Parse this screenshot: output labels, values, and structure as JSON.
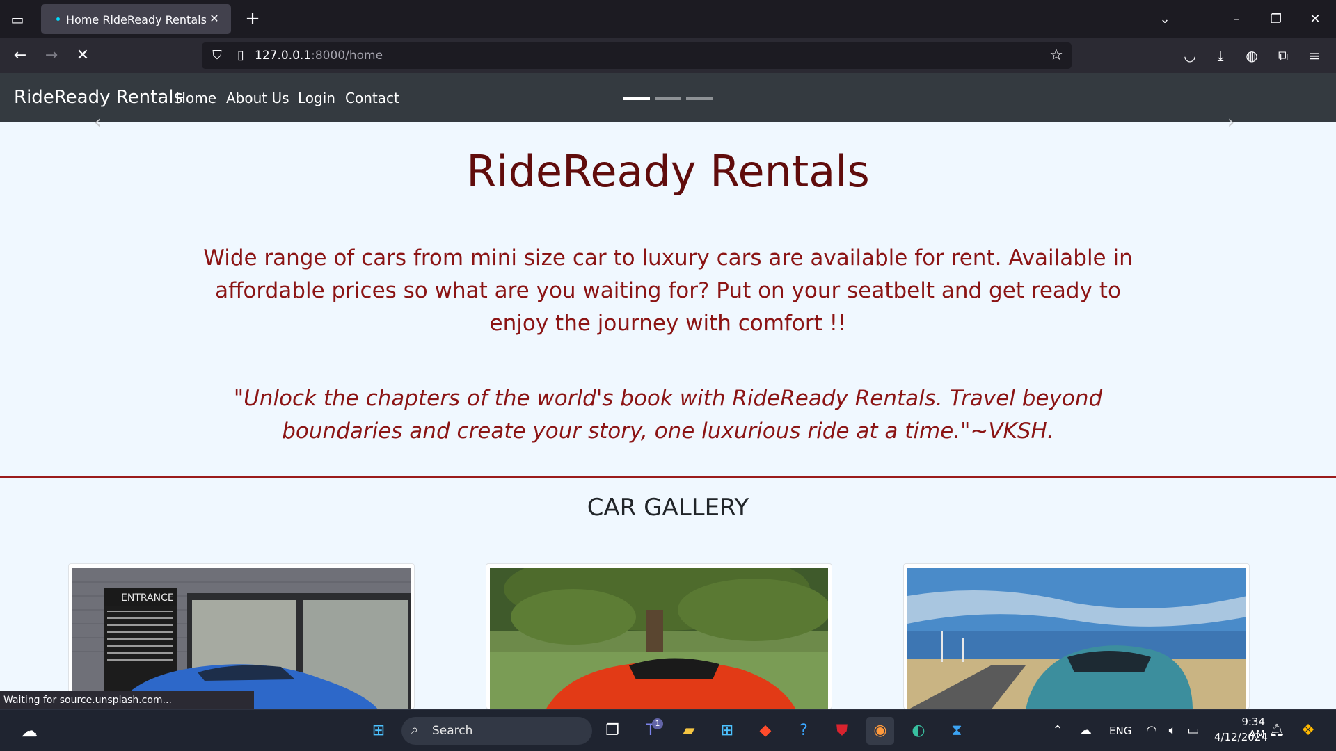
{
  "browser": {
    "tab_title": "Home RideReady Rentals",
    "url_host": "127.0.0.1",
    "url_rest": ":8000/home",
    "status_text": "Waiting for source.unsplash.com..."
  },
  "site": {
    "brand": "RideReady Rentals",
    "nav": [
      "Home",
      "About Us",
      "Login",
      "Contact"
    ],
    "hero_title": "RideReady Rentals",
    "hero_description": "Wide range of cars from mini size car to luxury cars are available for rent. Available in affordable prices so what are you waiting for? Put on your seatbelt and get ready to enjoy the journey with comfort !!",
    "hero_quote": "\"Unlock the chapters of the world's book with RideReady Rentals. Travel beyond boundaries and create your story, one luxurious ride at a time.\"~VKSH.",
    "gallery_title": "CAR GALLERY",
    "entrance_sign": "ENTRANCE"
  },
  "taskbar": {
    "search_label": "Search",
    "teams_badge": "1",
    "language": "ENG",
    "time": "9:34 AM",
    "date": "4/12/2024"
  },
  "colors": {
    "navbar": "#343a40",
    "page_bg": "#f0f8ff",
    "accent_dark_red": "#600c0c",
    "accent_red": "#8b1414"
  }
}
